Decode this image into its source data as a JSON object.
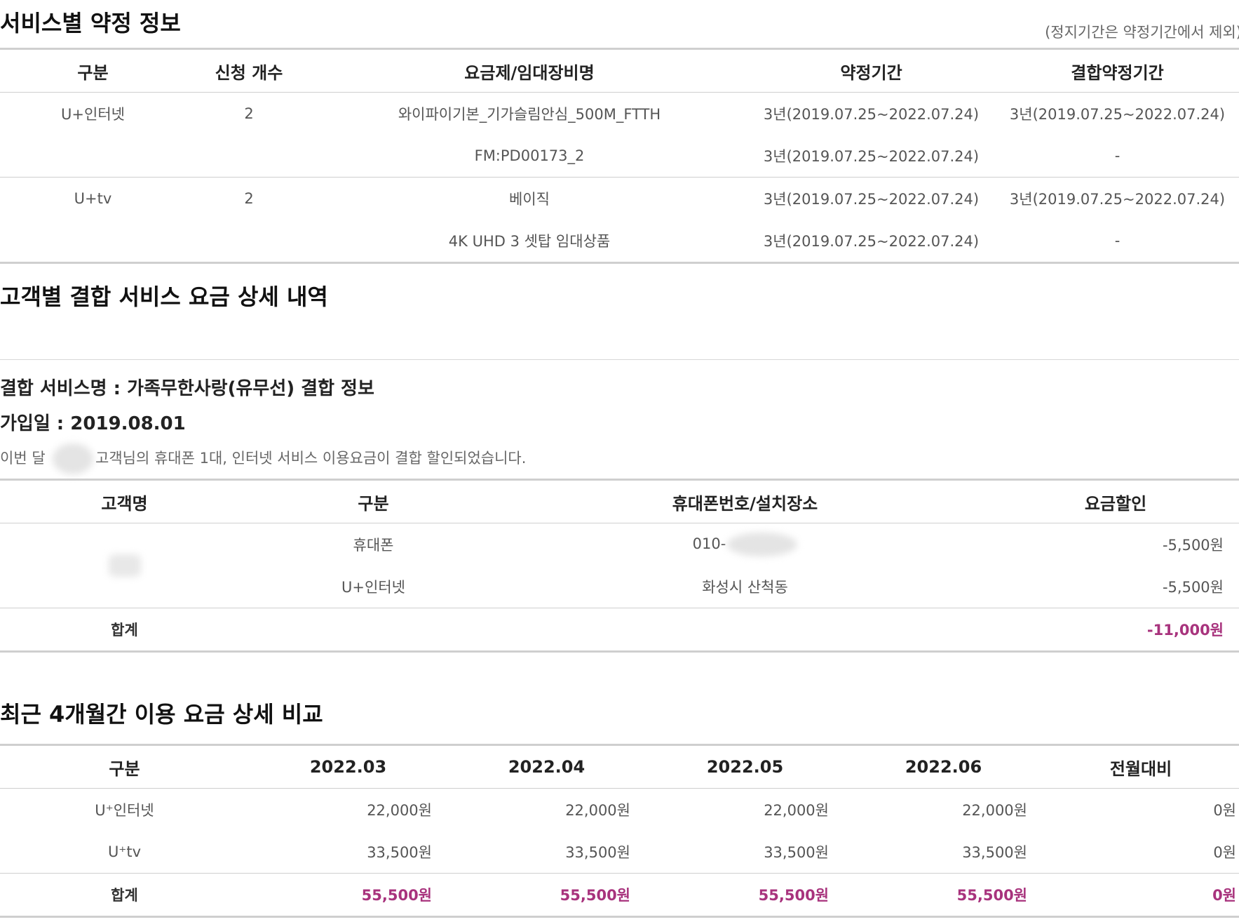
{
  "contract": {
    "title": "서비스별 약정 정보",
    "note": "(정지기간은 약정기간에서 제외)",
    "headers": [
      "구분",
      "신청 개수",
      "요금제/임대장비명",
      "약정기간",
      "결합약정기간"
    ],
    "rows": [
      [
        "U+인터넷",
        "2",
        "와이파이기본_기가슬림안심_500M_FTTH",
        "3년(2019.07.25~2022.07.24)",
        "3년(2019.07.25~2022.07.24)"
      ],
      [
        "",
        "",
        "FM:PD00173_2",
        "3년(2019.07.25~2022.07.24)",
        "-"
      ],
      [
        "U+tv",
        "2",
        "베이직",
        "3년(2019.07.25~2022.07.24)",
        "3년(2019.07.25~2022.07.24)"
      ],
      [
        "",
        "",
        "4K UHD 3 셋탑 임대상품",
        "3년(2019.07.25~2022.07.24)",
        "-"
      ]
    ]
  },
  "combo": {
    "title": "고객별 결합 서비스 요금 상세 내역",
    "service_name": "결합 서비스명 : 가족무한사랑(유무선) 결합 정보",
    "join_date": "가입일 : 2019.08.01",
    "desc_prefix": "이번 달",
    "desc_suffix": "고객님의 휴대폰 1대, 인터넷 서비스 이용요금이 결합 할인되었습니다.",
    "headers": [
      "고객명",
      "구분",
      "휴대폰번호/설치장소",
      "요금할인"
    ],
    "rows": [
      [
        "",
        "휴대폰",
        "010-",
        "-5,500원"
      ],
      [
        "",
        "U+인터넷",
        "화성시 산척동",
        "-5,500원"
      ]
    ],
    "total": [
      "합계",
      "",
      "",
      "-11,000원"
    ]
  },
  "recent": {
    "title": "최근 4개월간 이용 요금 상세 비교",
    "headers": [
      "구분",
      "2022.03",
      "2022.04",
      "2022.05",
      "2022.06",
      "전월대비"
    ],
    "rows": [
      [
        "U⁺인터넷",
        "22,000원",
        "22,000원",
        "22,000원",
        "22,000원",
        "0원"
      ],
      [
        "U⁺tv",
        "33,500원",
        "33,500원",
        "33,500원",
        "33,500원",
        "0원"
      ]
    ],
    "total": [
      "합계",
      "55,500원",
      "55,500원",
      "55,500원",
      "55,500원",
      "0원"
    ]
  },
  "colors": {
    "accent": "#a8337d",
    "border": "#cfcfcf"
  }
}
